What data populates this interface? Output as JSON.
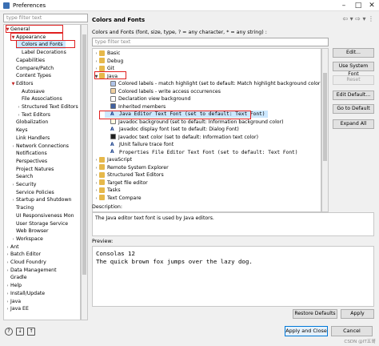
{
  "window": {
    "title": "Preferences"
  },
  "left": {
    "filter_placeholder": "type filter text",
    "tree": [
      {
        "label": "General",
        "arrow": "▼",
        "indent": 0
      },
      {
        "label": "Appearance",
        "arrow": "▼",
        "indent": 1
      },
      {
        "label": "Colors and Fonts",
        "arrow": "",
        "indent": 2
      },
      {
        "label": "Label Decorations",
        "arrow": "",
        "indent": 2
      },
      {
        "label": "Capabilities",
        "arrow": "",
        "indent": 1
      },
      {
        "label": "Compare/Patch",
        "arrow": "",
        "indent": 1
      },
      {
        "label": "Content Types",
        "arrow": "",
        "indent": 1
      },
      {
        "label": "Editors",
        "arrow": "▼",
        "indent": 1
      },
      {
        "label": "Autosave",
        "arrow": "",
        "indent": 2
      },
      {
        "label": "File Associations",
        "arrow": "",
        "indent": 2
      },
      {
        "label": "Structured Text Editors",
        "arrow": ">",
        "indent": 2
      },
      {
        "label": "Text Editors",
        "arrow": ">",
        "indent": 2
      },
      {
        "label": "Globalization",
        "arrow": "",
        "indent": 1
      },
      {
        "label": "Keys",
        "arrow": "",
        "indent": 1
      },
      {
        "label": "Link Handlers",
        "arrow": "",
        "indent": 1
      },
      {
        "label": "Network Connections",
        "arrow": ">",
        "indent": 1
      },
      {
        "label": "Notifications",
        "arrow": "",
        "indent": 1
      },
      {
        "label": "Perspectives",
        "arrow": "",
        "indent": 1
      },
      {
        "label": "Project Natures",
        "arrow": "",
        "indent": 1
      },
      {
        "label": "Search",
        "arrow": "",
        "indent": 1
      },
      {
        "label": "Security",
        "arrow": ">",
        "indent": 1
      },
      {
        "label": "Service Policies",
        "arrow": "",
        "indent": 1
      },
      {
        "label": "Startup and Shutdown",
        "arrow": ">",
        "indent": 1
      },
      {
        "label": "Tracing",
        "arrow": "",
        "indent": 1
      },
      {
        "label": "UI Responsiveness Mon",
        "arrow": "",
        "indent": 1
      },
      {
        "label": "User Storage Service",
        "arrow": "",
        "indent": 1
      },
      {
        "label": "Web Browser",
        "arrow": "",
        "indent": 1
      },
      {
        "label": "Workspace",
        "arrow": ">",
        "indent": 1
      },
      {
        "label": "Ant",
        "arrow": ">",
        "indent": 0
      },
      {
        "label": "Batch Editor",
        "arrow": ">",
        "indent": 0
      },
      {
        "label": "Cloud Foundry",
        "arrow": ">",
        "indent": 0
      },
      {
        "label": "Data Management",
        "arrow": ">",
        "indent": 0
      },
      {
        "label": "Gradle",
        "arrow": "",
        "indent": 0
      },
      {
        "label": "Help",
        "arrow": ">",
        "indent": 0
      },
      {
        "label": "Install/Update",
        "arrow": ">",
        "indent": 0
      },
      {
        "label": "Java",
        "arrow": ">",
        "indent": 0
      },
      {
        "label": "Java EE",
        "arrow": ">",
        "indent": 0
      }
    ]
  },
  "main": {
    "title": "Colors and Fonts",
    "description": "Colors and Fonts (font, size, type, ? = any character, * = any string) :",
    "filter_placeholder": "type filter text",
    "tree": [
      {
        "label": "Basic",
        "arrow": ">",
        "indent": 0,
        "icon": "folder"
      },
      {
        "label": "Debug",
        "arrow": ">",
        "indent": 0,
        "icon": "folder"
      },
      {
        "label": "Git",
        "arrow": ">",
        "indent": 0,
        "icon": "folder"
      },
      {
        "label": "Java",
        "arrow": "▼",
        "indent": 0,
        "icon": "folder"
      },
      {
        "label": "Colored labels - match highlight (set to default: Match highlight background color)",
        "arrow": "",
        "indent": 1,
        "icon": "color",
        "color": "#b0c4e8"
      },
      {
        "label": "Colored labels - write access occurrences",
        "arrow": "",
        "indent": 1,
        "icon": "color",
        "color": "#f0d0a0"
      },
      {
        "label": "Declaration view background",
        "arrow": "",
        "indent": 1,
        "icon": "color",
        "color": "#ffffff"
      },
      {
        "label": "Inherited members",
        "arrow": "",
        "indent": 1,
        "icon": "color",
        "color": "#4060a0"
      },
      {
        "label": "Java Editor Text Font (set to default: Text Font)",
        "arrow": "",
        "indent": 1,
        "icon": "font",
        "mono": true
      },
      {
        "label": "Javadoc background (set to default: Information background color)",
        "arrow": "",
        "indent": 1,
        "icon": "color",
        "color": "#ffffe0"
      },
      {
        "label": "Javadoc display font (set to default: Dialog Font)",
        "arrow": "",
        "indent": 1,
        "icon": "font"
      },
      {
        "label": "Javadoc text color (set to default: Information text color)",
        "arrow": "",
        "indent": 1,
        "icon": "color",
        "color": "#202020"
      },
      {
        "label": "JUnit failure trace font",
        "arrow": "",
        "indent": 1,
        "icon": "font"
      },
      {
        "label": "Properties File Editor Text Font (set to default: Text Font)",
        "arrow": "",
        "indent": 1,
        "icon": "font",
        "mono": true
      },
      {
        "label": "JavaScript",
        "arrow": ">",
        "indent": 0,
        "icon": "folder"
      },
      {
        "label": "Remote System Explorer",
        "arrow": ">",
        "indent": 0,
        "icon": "folder"
      },
      {
        "label": "Structured Text Editors",
        "arrow": ">",
        "indent": 0,
        "icon": "folder"
      },
      {
        "label": "Target file editor",
        "arrow": ">",
        "indent": 0,
        "icon": "folder"
      },
      {
        "label": "Tasks",
        "arrow": ">",
        "indent": 0,
        "icon": "folder"
      },
      {
        "label": "Text Compare",
        "arrow": ">",
        "indent": 0,
        "icon": "folder"
      }
    ],
    "buttons": {
      "edit": "Edit...",
      "use_system_font": "Use System Font",
      "reset": "Reset",
      "edit_default": "Edit Default...",
      "go_to_default": "Go to Default",
      "expand_all": "Expand All"
    },
    "description_label": "Description:",
    "description_text": "The Java editor text font is used by Java editors.",
    "preview_label": "Preview:",
    "preview_lines": [
      "Consolas 12",
      "The quick brown fox jumps over the lazy dog."
    ],
    "restore_defaults": "Restore Defaults",
    "apply": "Apply"
  },
  "footer": {
    "apply_and_close": "Apply and Close",
    "cancel": "Cancel",
    "watermark": "CSDN @IT五哥"
  },
  "colors": {
    "highlight_border": "#e02020",
    "selection": "#cce8ff"
  }
}
